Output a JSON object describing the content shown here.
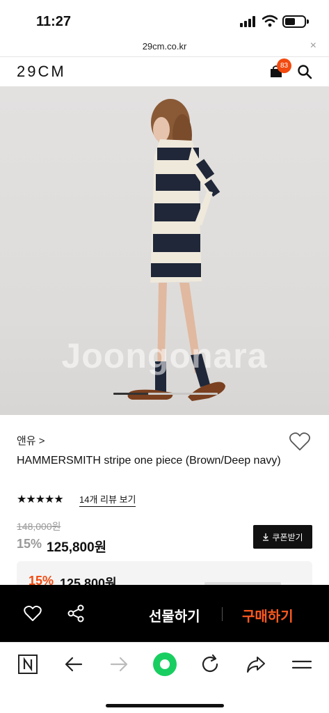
{
  "status_bar": {
    "time": "11:27"
  },
  "browser": {
    "url": "29cm.co.kr",
    "close_glyph": "×"
  },
  "header": {
    "logo": "29CM",
    "cart_count": "83"
  },
  "hero": {
    "watermark": "Joongonara",
    "slide_index": 1
  },
  "product": {
    "brand": "앤유 >",
    "name": "HAMMERSMITH stripe one piece (Brown/Deep navy)",
    "stars": "★★★★★",
    "rating": 5,
    "review_link": "14개 리뷰 보기",
    "original_price": "148,000원",
    "discount_rate": "15%",
    "sale_price": "125,800원",
    "coupon_label": "쿠폰받기",
    "coupon_icon": "download-icon"
  },
  "coupon_panel": {
    "discount_rate": "15%",
    "price": "125,800원"
  },
  "action_bar": {
    "gift_label": "선물하기",
    "buy_label": "구매하기",
    "buy_color": "#ff5a1f"
  },
  "toolbar": {
    "icons": [
      "naver-n-icon",
      "back-arrow-icon",
      "forward-arrow-icon",
      "green-dot-icon",
      "refresh-icon",
      "share-arrow-icon",
      "menu-icon"
    ],
    "accent": "#19ce60"
  },
  "colors": {
    "brand_orange": "#f24a0f",
    "navy_stripe": "#1f2738",
    "cream_stripe": "#efe9dc"
  }
}
